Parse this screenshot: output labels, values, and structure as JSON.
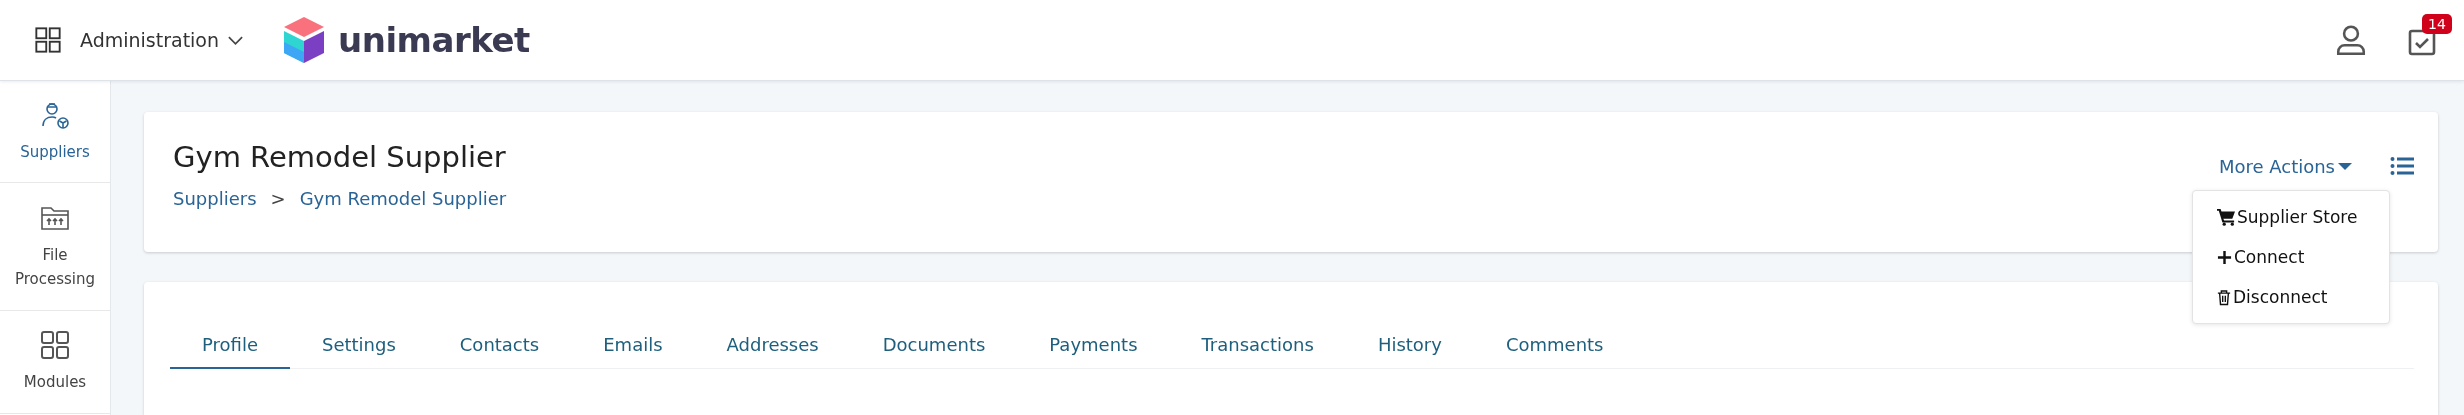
{
  "header": {
    "module_menu": "Administration",
    "logo_text": "unimarket",
    "tasks_badge": "14"
  },
  "sidebar": {
    "items": [
      {
        "label": "Suppliers",
        "selected": true
      },
      {
        "label": "File Processing",
        "selected": false
      },
      {
        "label": "Modules",
        "selected": false
      }
    ]
  },
  "page": {
    "title": "Gym Remodel Supplier",
    "breadcrumb": [
      "Suppliers",
      "Gym Remodel Supplier"
    ],
    "breadcrumb_separator": ">",
    "more_actions": {
      "label": "More Actions",
      "expanded": true,
      "items": [
        {
          "label": "Supplier Store"
        },
        {
          "label": "Connect"
        },
        {
          "label": "Disconnect"
        }
      ]
    }
  },
  "tabs": [
    {
      "label": "Profile",
      "selected": true
    },
    {
      "label": "Settings",
      "selected": false
    },
    {
      "label": "Contacts",
      "selected": false
    },
    {
      "label": "Emails",
      "selected": false
    },
    {
      "label": "Addresses",
      "selected": false
    },
    {
      "label": "Documents",
      "selected": false
    },
    {
      "label": "Payments",
      "selected": false
    },
    {
      "label": "Transactions",
      "selected": false
    },
    {
      "label": "History",
      "selected": false
    },
    {
      "label": "Comments",
      "selected": false
    }
  ]
}
